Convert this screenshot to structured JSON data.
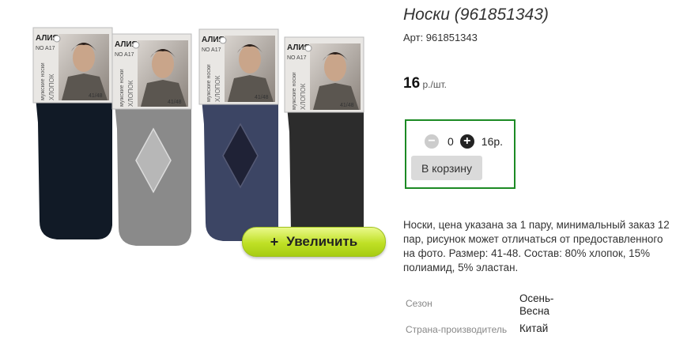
{
  "product": {
    "title": "Носки (961851343)",
    "sku": "Арт: 961851343",
    "price_value": "16",
    "price_unit": " р./шт.",
    "description": "Носки, цена указана за 1 пару, минимальный заказ 12 пар, рисунок может отличаться от предоставленного на фото. Размер: 41-48. Состав: 80% хлопок, 15% полиамид, 5% эластан."
  },
  "gallery": {
    "zoom_icon": "+",
    "zoom_label": "Увеличить",
    "image_alt": "",
    "package_brand": "АЛИЯ",
    "package_model": "NO A17",
    "package_size": "41/48",
    "package_side_1": "мужские носки",
    "package_side_2": "ХЛОПОК",
    "sock_colors": [
      "#111a26",
      "#8a8a8a",
      "#3c4564",
      "#2c2c2c"
    ]
  },
  "cart": {
    "minus_icon": "−",
    "quantity": "0",
    "plus_icon": "+",
    "sum": "16р.",
    "add_button": "В корзину"
  },
  "properties": [
    {
      "key": "Сезон",
      "value": "Осень-Весна"
    },
    {
      "key": "Страна-производитель",
      "value": "Китай"
    }
  ],
  "colors": {
    "accent_border": "#1c8a24",
    "zoom_button": "#bfe025"
  }
}
